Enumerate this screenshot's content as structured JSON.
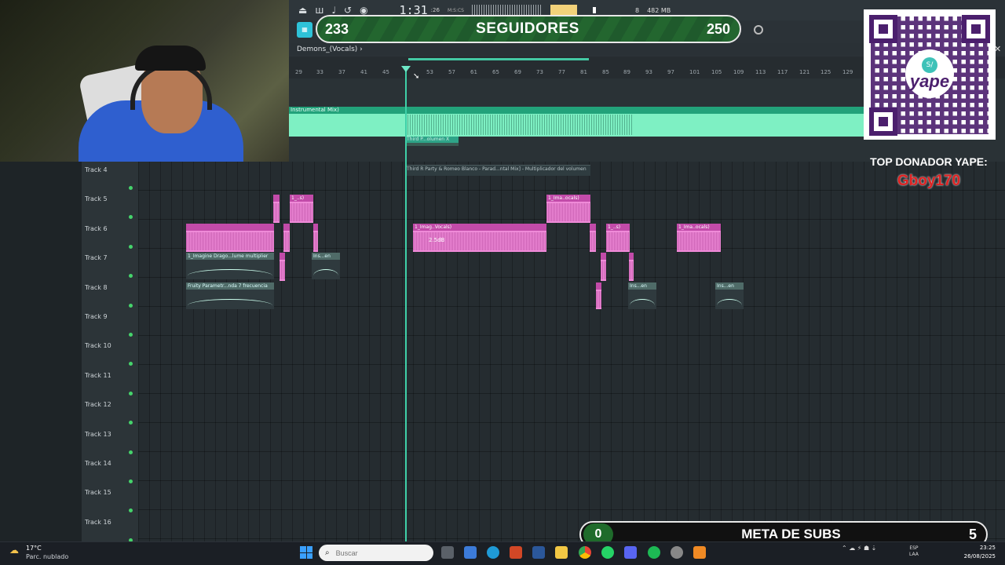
{
  "toolbar": {
    "time": "1:31",
    "time_sub": ":26",
    "time_unit": "M:S:CS",
    "memory": "482 MB",
    "cpu": "8"
  },
  "breadcrumb": "Demons_(Vocals) ›",
  "followers": {
    "current": "233",
    "label": "SEGUIDORES",
    "goal": "250"
  },
  "ruler_ticks": [
    "29",
    "33",
    "37",
    "41",
    "45",
    "53",
    "57",
    "61",
    "65",
    "69",
    "73",
    "77",
    "81",
    "85",
    "89",
    "93",
    "97",
    "101",
    "105",
    "109",
    "113",
    "117",
    "121",
    "125",
    "129"
  ],
  "tracks": [
    "Track 4",
    "Track 5",
    "Track 6",
    "Track 7",
    "Track 8",
    "Track 9",
    "Track 10",
    "Track 11",
    "Track 12",
    "Track 13",
    "Track 14",
    "Track 15",
    "Track 16"
  ],
  "clips": {
    "instrumental": "Instrumental Mix)",
    "automation1": "Third P...olumen X",
    "automation2": "Third R Party & Romeo Blanco - Parad...ntal Mix] - Multiplicador del volumen",
    "imagine_vol": "1_Imagine Drago...lume multiplier",
    "fruity": "Fruity Parametr...nda 7 frecuencia",
    "ins_en": "Ins...en",
    "vocals_a": "1_Imag..Vocals)",
    "vocals_s": "1_..s)",
    "vocals_b": "1_Ima..ocals)",
    "gain": "2.5dB"
  },
  "donor": {
    "title": "TOP DONADOR YAPE:",
    "name": "Gboy170",
    "brand": "yape"
  },
  "subs": {
    "current": "0",
    "label": "META DE SUBS",
    "goal": "5"
  },
  "taskbar": {
    "temp": "17°C",
    "weather": "Parc. nublado",
    "search_placeholder": "Buscar",
    "lang1": "ESP",
    "lang2": "LAA",
    "time": "23:25",
    "date": "26/08/2025"
  },
  "colors": {
    "accent": "#3fd0a8",
    "clip_pink": "#ef8ad8",
    "clip_green": "#7ef0c3",
    "followers_green": "#23662f",
    "donor_red": "#e02222"
  }
}
